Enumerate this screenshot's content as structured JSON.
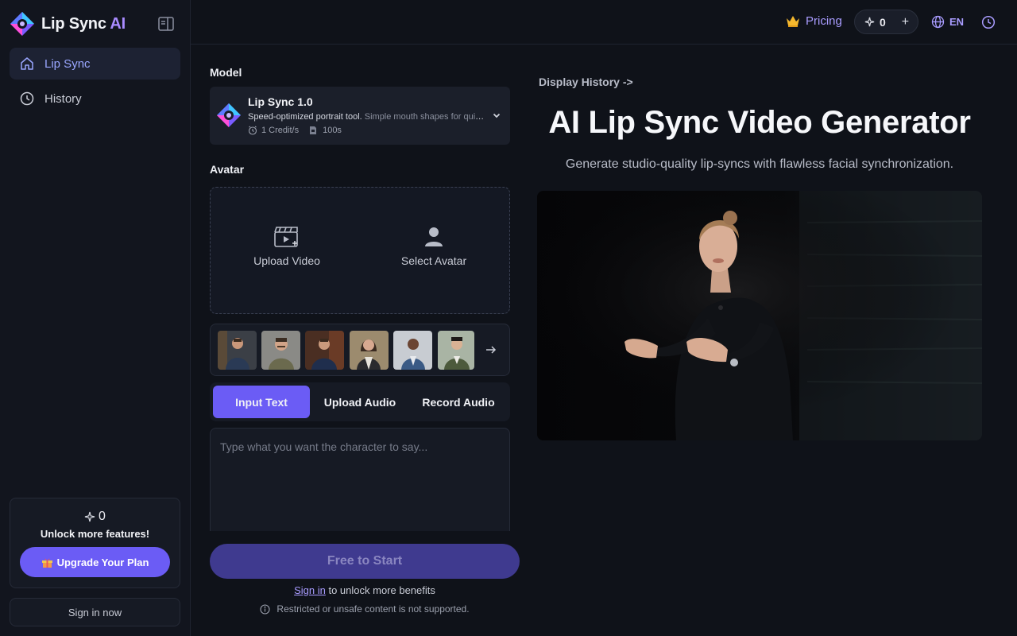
{
  "sidebar": {
    "brand_name": "Lip Sync",
    "brand_suffix": "AI",
    "items": [
      {
        "label": "Lip Sync",
        "icon": "home-icon"
      },
      {
        "label": "History",
        "icon": "clock-icon"
      }
    ],
    "credits_count": "0",
    "unlock_text": "Unlock more features!",
    "upgrade_label": "Upgrade Your Plan",
    "signin_label": "Sign in now"
  },
  "header": {
    "pricing_label": "Pricing",
    "credits": "0",
    "plus": "+",
    "language": "EN"
  },
  "form": {
    "model_label": "Model",
    "model": {
      "name": "Lip Sync 1.0",
      "desc_main": "Speed-optimized portrait tool.",
      "desc_muted": "Simple mouth shapes for quick results",
      "credit_rate": "1 Credit/s",
      "duration": "100s"
    },
    "avatar_label": "Avatar",
    "upload_video": "Upload Video",
    "select_avatar": "Select Avatar",
    "tabs": [
      "Input Text",
      "Upload Audio",
      "Record Audio"
    ],
    "text_placeholder": "Type what you want the character to say...",
    "start_label": "Free to Start",
    "signin_link": "Sign in",
    "signin_suffix": " to unlock more benefits",
    "restricted": "Restricted or unsafe content is not supported."
  },
  "main": {
    "display_history": "Display History ->",
    "title": "AI Lip Sync Video Generator",
    "subtitle": "Generate studio-quality lip-syncs with flawless facial synchronization."
  },
  "colors": {
    "accent": "#6b5cf5",
    "accent_text": "#a99cff",
    "background": "#0f1219"
  }
}
